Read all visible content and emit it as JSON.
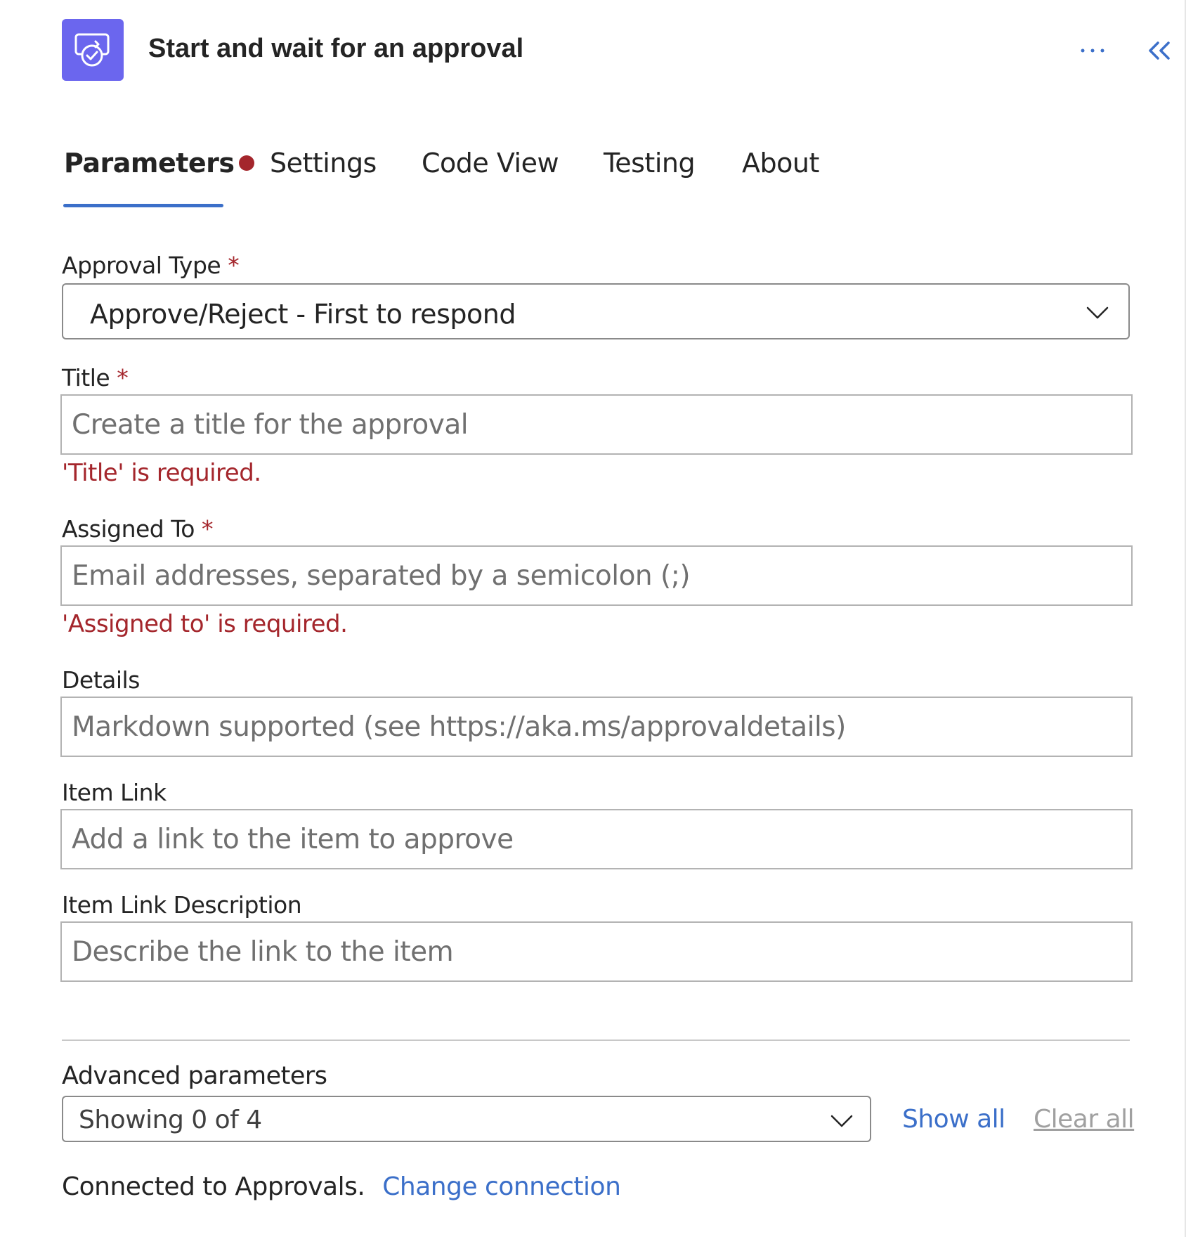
{
  "header": {
    "title": "Start and wait for an approval",
    "icon": "approval-icon",
    "icon_color": "#6b66ee",
    "more_icon": "more-horizontal-icon",
    "collapse_icon": "double-chevron-left-icon"
  },
  "tabs": [
    {
      "label": "Parameters",
      "active": true,
      "has_error": true
    },
    {
      "label": "Settings",
      "active": false
    },
    {
      "label": "Code View",
      "active": false
    },
    {
      "label": "Testing",
      "active": false
    },
    {
      "label": "About",
      "active": false
    }
  ],
  "fields": {
    "approval_type": {
      "label": "Approval Type",
      "required_mark": "*",
      "value": "Approve/Reject - First to respond"
    },
    "title": {
      "label": "Title",
      "required_mark": "*",
      "placeholder": "Create a title for the approval",
      "error": "'Title' is required."
    },
    "assigned_to": {
      "label": "Assigned To",
      "required_mark": "*",
      "placeholder": "Email addresses, separated by a semicolon (;)",
      "error": "'Assigned to' is required."
    },
    "details": {
      "label": "Details",
      "placeholder": "Markdown supported (see https://aka.ms/approvaldetails)"
    },
    "item_link": {
      "label": "Item Link",
      "placeholder": "Add a link to the item to approve"
    },
    "item_link_description": {
      "label": "Item Link Description",
      "placeholder": "Describe the link to the item"
    }
  },
  "advanced": {
    "label": "Advanced parameters",
    "value": "Showing 0 of 4",
    "show_all": "Show all",
    "clear_all": "Clear all"
  },
  "footer": {
    "connected_text": "Connected to Approvals.",
    "change_connection": "Change connection"
  },
  "colors": {
    "accent": "#3b6fc9",
    "error": "#a4262c",
    "brand": "#6b66ee"
  }
}
